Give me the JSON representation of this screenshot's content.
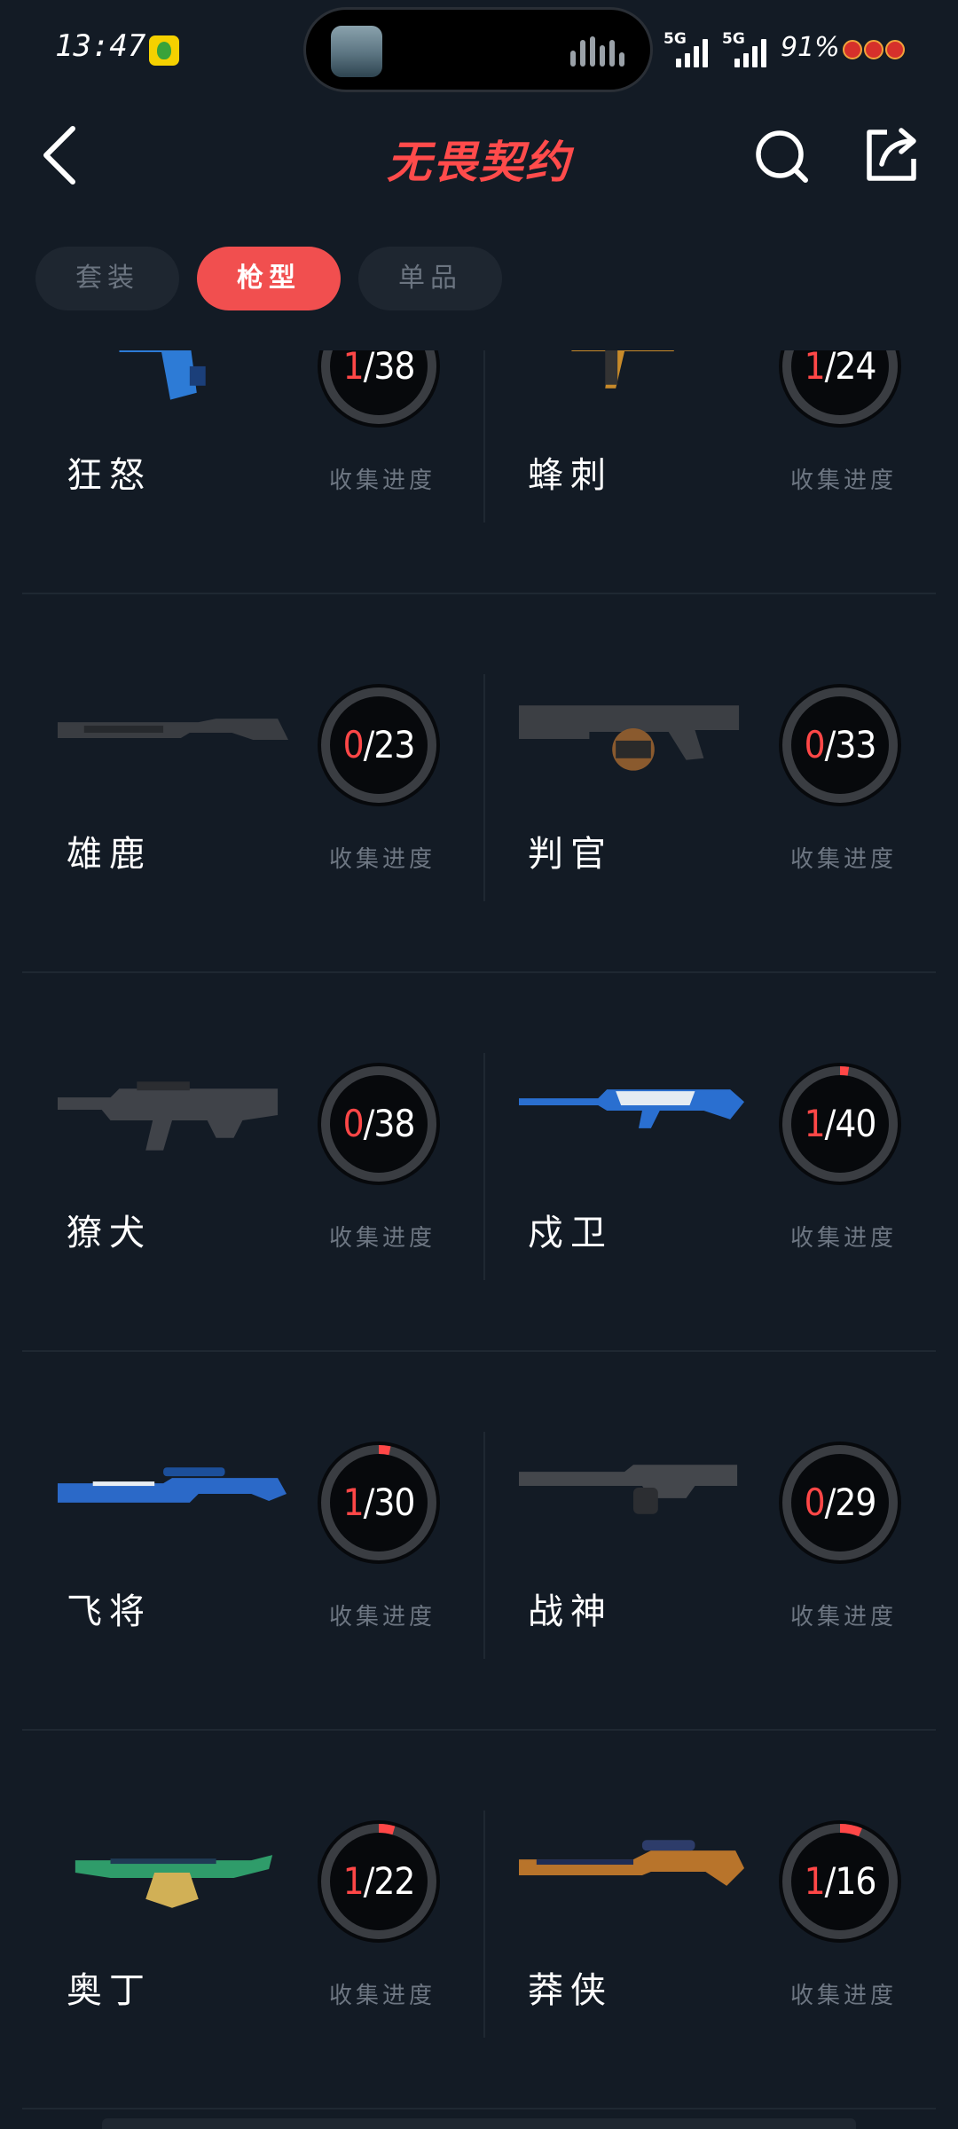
{
  "status_bar": {
    "time": "13:47",
    "network_1": "5G",
    "network_2": "5G",
    "battery": "91%"
  },
  "header": {
    "title": "无畏契约"
  },
  "tabs": [
    {
      "label": "套装",
      "active": false
    },
    {
      "label": "枪型",
      "active": true
    },
    {
      "label": "单品",
      "active": false
    }
  ],
  "caption": "收集进度",
  "colors": {
    "background": "#131b25",
    "accent": "#f14f4f",
    "progress": "#ff4747"
  },
  "weapons": [
    {
      "name": "狂怒",
      "collected": 1,
      "total": 38,
      "gun_icon": "pistol-blue-skin-icon"
    },
    {
      "name": "蜂刺",
      "collected": 1,
      "total": 24,
      "gun_icon": "smg-gold-skin-icon"
    },
    {
      "name": "雄鹿",
      "collected": 0,
      "total": 23,
      "gun_icon": "shotgun-default-icon"
    },
    {
      "name": "判官",
      "collected": 0,
      "total": 33,
      "gun_icon": "drum-shotgun-default-icon"
    },
    {
      "name": "獠犬",
      "collected": 0,
      "total": 38,
      "gun_icon": "bullpup-rifle-default-icon"
    },
    {
      "name": "戍卫",
      "collected": 1,
      "total": 40,
      "gun_icon": "rifle-blue-skin-icon"
    },
    {
      "name": "飞将",
      "collected": 1,
      "total": 30,
      "gun_icon": "sniper-blue-skin-icon"
    },
    {
      "name": "战神",
      "collected": 0,
      "total": 29,
      "gun_icon": "lmg-default-icon"
    },
    {
      "name": "奥丁",
      "collected": 1,
      "total": 22,
      "gun_icon": "heavy-mg-green-skin-icon"
    },
    {
      "name": "莽侠",
      "collected": 1,
      "total": 16,
      "gun_icon": "marshal-sniper-skin-icon"
    }
  ]
}
